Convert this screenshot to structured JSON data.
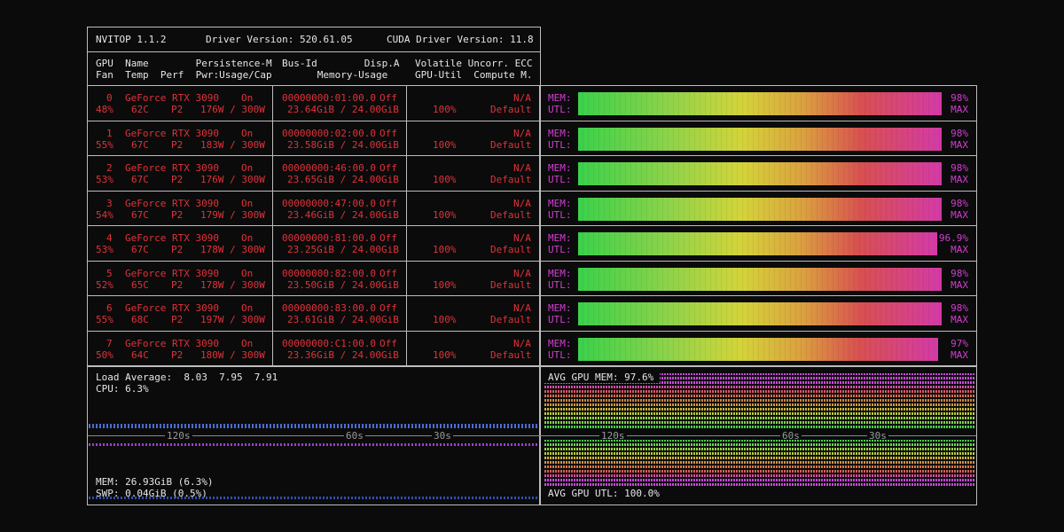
{
  "header": {
    "app": "NVITOP 1.1.2",
    "driver": "Driver Version: 520.61.05",
    "cuda": "CUDA Driver Version: 11.8"
  },
  "columns": {
    "c1_l1": "GPU  Name        Persistence-M",
    "c1_l2": "Fan  Temp  Perf  Pwr:Usage/Cap",
    "c2_l1": "Bus-Id        Disp.A",
    "c2_l2": "      Memory-Usage",
    "c3_l1": "Volatile Uncorr. ECC",
    "c3_l2": "GPU-Util  Compute M."
  },
  "gpus": [
    {
      "id": "0",
      "name": "GeForce RTX 3090",
      "persist": "On",
      "fan": "48%",
      "temp": "62C",
      "perf": "P2",
      "pwr": "176W / 300W",
      "bus": "00000000:01:00.0",
      "disp": "Off",
      "mem": "23.64GiB / 24.00GiB",
      "ecc": "N/A",
      "util": "100%",
      "compute": "Default",
      "mem_pct": "98%",
      "mem_fill": 0.98,
      "utl_pct": "MAX"
    },
    {
      "id": "1",
      "name": "GeForce RTX 3090",
      "persist": "On",
      "fan": "55%",
      "temp": "67C",
      "perf": "P2",
      "pwr": "183W / 300W",
      "bus": "00000000:02:00.0",
      "disp": "Off",
      "mem": "23.58GiB / 24.00GiB",
      "ecc": "N/A",
      "util": "100%",
      "compute": "Default",
      "mem_pct": "98%",
      "mem_fill": 0.98,
      "utl_pct": "MAX"
    },
    {
      "id": "2",
      "name": "GeForce RTX 3090",
      "persist": "On",
      "fan": "53%",
      "temp": "67C",
      "perf": "P2",
      "pwr": "176W / 300W",
      "bus": "00000000:46:00.0",
      "disp": "Off",
      "mem": "23.65GiB / 24.00GiB",
      "ecc": "N/A",
      "util": "100%",
      "compute": "Default",
      "mem_pct": "98%",
      "mem_fill": 0.98,
      "utl_pct": "MAX"
    },
    {
      "id": "3",
      "name": "GeForce RTX 3090",
      "persist": "On",
      "fan": "54%",
      "temp": "67C",
      "perf": "P2",
      "pwr": "179W / 300W",
      "bus": "00000000:47:00.0",
      "disp": "Off",
      "mem": "23.46GiB / 24.00GiB",
      "ecc": "N/A",
      "util": "100%",
      "compute": "Default",
      "mem_pct": "98%",
      "mem_fill": 0.98,
      "utl_pct": "MAX"
    },
    {
      "id": "4",
      "name": "GeForce RTX 3090",
      "persist": "On",
      "fan": "53%",
      "temp": "67C",
      "perf": "P2",
      "pwr": "178W / 300W",
      "bus": "00000000:81:00.0",
      "disp": "Off",
      "mem": "23.25GiB / 24.00GiB",
      "ecc": "N/A",
      "util": "100%",
      "compute": "Default",
      "mem_pct": "96.9%",
      "mem_fill": 0.969,
      "utl_pct": "MAX"
    },
    {
      "id": "5",
      "name": "GeForce RTX 3090",
      "persist": "On",
      "fan": "52%",
      "temp": "65C",
      "perf": "P2",
      "pwr": "178W / 300W",
      "bus": "00000000:82:00.0",
      "disp": "Off",
      "mem": "23.50GiB / 24.00GiB",
      "ecc": "N/A",
      "util": "100%",
      "compute": "Default",
      "mem_pct": "98%",
      "mem_fill": 0.98,
      "utl_pct": "MAX"
    },
    {
      "id": "6",
      "name": "GeForce RTX 3090",
      "persist": "On",
      "fan": "55%",
      "temp": "68C",
      "perf": "P2",
      "pwr": "197W / 300W",
      "bus": "00000000:83:00.0",
      "disp": "Off",
      "mem": "23.61GiB / 24.00GiB",
      "ecc": "N/A",
      "util": "100%",
      "compute": "Default",
      "mem_pct": "98%",
      "mem_fill": 0.98,
      "utl_pct": "MAX"
    },
    {
      "id": "7",
      "name": "GeForce RTX 3090",
      "persist": "On",
      "fan": "50%",
      "temp": "64C",
      "perf": "P2",
      "pwr": "180W / 300W",
      "bus": "00000000:C1:00.0",
      "disp": "Off",
      "mem": "23.36GiB / 24.00GiB",
      "ecc": "N/A",
      "util": "100%",
      "compute": "Default",
      "mem_pct": "97%",
      "mem_fill": 0.97,
      "utl_pct": "MAX"
    }
  ],
  "labels": {
    "mem": "MEM:",
    "utl": "UTL:"
  },
  "host": {
    "load": "Load Average:  8.03  7.95  7.91",
    "cpu": "CPU: 6.3%",
    "mem": "MEM: 26.93GiB (6.3%)",
    "swp": "SWP: 0.04GiB (0.5%)"
  },
  "avg": {
    "mem": "AVG GPU MEM: 97.6%",
    "utl": "AVG GPU UTL: 100.0%"
  },
  "ticks": {
    "t120": "120s",
    "t60": "60s",
    "t30": "30s"
  },
  "colors": {
    "red": "#e0323a",
    "magenta": "#d23dd2",
    "border": "#bdbdbd"
  }
}
